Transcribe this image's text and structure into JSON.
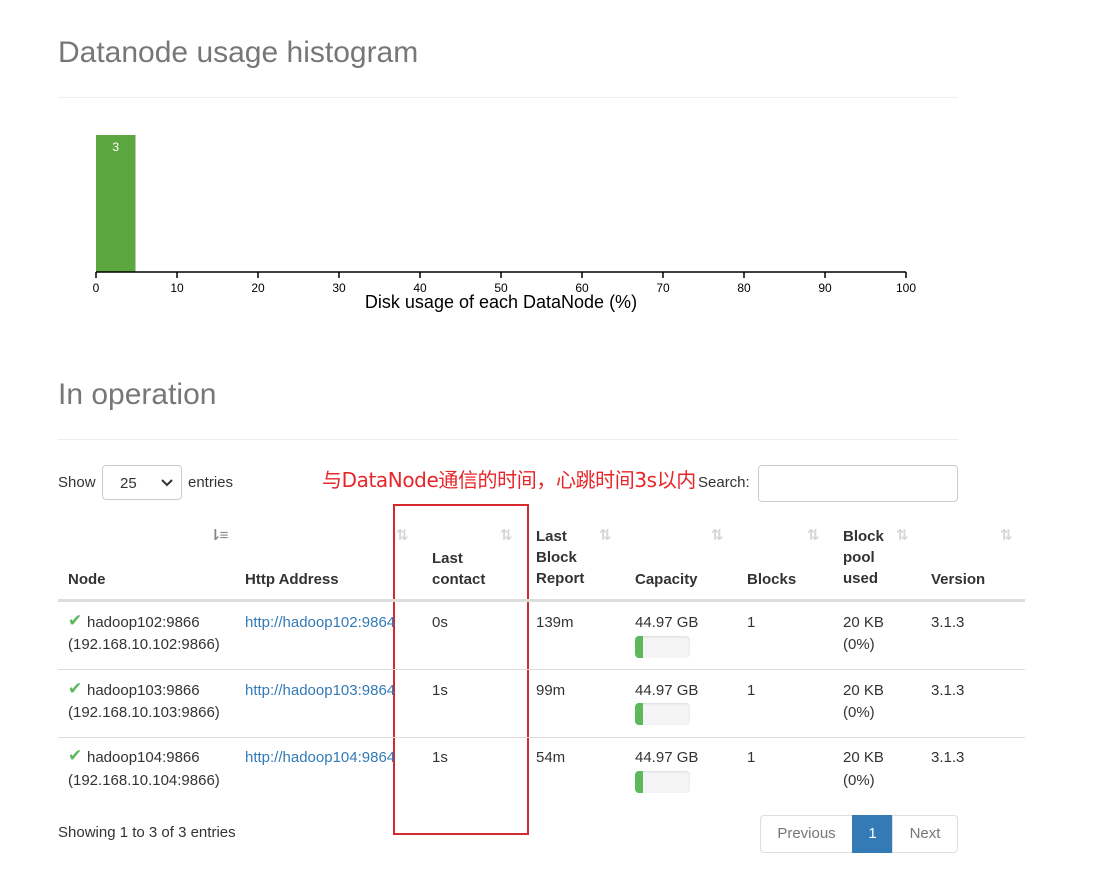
{
  "histogram": {
    "title": "Datanode usage histogram"
  },
  "chart_data": {
    "type": "bar",
    "title": "",
    "xlabel": "Disk usage of each DataNode (%)",
    "ylabel": "",
    "xlim": [
      0,
      100
    ],
    "x_ticks": [
      "0",
      "10",
      "20",
      "30",
      "40",
      "50",
      "60",
      "70",
      "80",
      "90",
      "100"
    ],
    "bins": [
      {
        "start": 0,
        "end": 5,
        "value": 3,
        "label": "3"
      }
    ],
    "bar_color": "#5ca73f",
    "grid": false
  },
  "operation": {
    "title": "In operation",
    "show_label": "Show",
    "entries_label": "entries",
    "page_length": "25",
    "search_label": "Search:",
    "search_value": ""
  },
  "annotation": {
    "text": "与DataNode通信的时间，心跳时间3s以内",
    "color": "#e8262a"
  },
  "table": {
    "headers": {
      "node": "Node",
      "http": "Http Address",
      "last_contact_1": "Last",
      "last_contact_2": "contact",
      "last_block_1": "Last",
      "last_block_2": "Block",
      "last_block_3": "Report",
      "capacity": "Capacity",
      "blocks": "Blocks",
      "pool_1": "Block",
      "pool_2": "pool",
      "pool_3": "used",
      "version": "Version"
    },
    "sort_icon_active": "⇂≡",
    "sort_icon": "⇅",
    "rows": [
      {
        "node": "hadoop102:9866",
        "ip": "(192.168.10.102:9866)",
        "http": "http://hadoop102:9864",
        "last_contact": "0s",
        "last_block": "139m",
        "capacity": "44.97 GB",
        "usage_percent": 0,
        "blocks": "1",
        "pool": "20 KB",
        "pool_pct": "(0%)",
        "version": "3.1.3"
      },
      {
        "node": "hadoop103:9866",
        "ip": "(192.168.10.103:9866)",
        "http": "http://hadoop103:9864",
        "last_contact": "1s",
        "last_block": "99m",
        "capacity": "44.97 GB",
        "usage_percent": 0,
        "blocks": "1",
        "pool": "20 KB",
        "pool_pct": "(0%)",
        "version": "3.1.3"
      },
      {
        "node": "hadoop104:9866",
        "ip": "(192.168.10.104:9866)",
        "http": "http://hadoop104:9864",
        "last_contact": "1s",
        "last_block": "54m",
        "capacity": "44.97 GB",
        "usage_percent": 0,
        "blocks": "1",
        "pool": "20 KB",
        "pool_pct": "(0%)",
        "version": "3.1.3"
      }
    ]
  },
  "footer": {
    "info": "Showing 1 to 3 of 3 entries",
    "previous": "Previous",
    "current_page": "1",
    "next": "Next"
  },
  "colors": {
    "accent": "#337ab7",
    "success": "#5cb85c"
  }
}
